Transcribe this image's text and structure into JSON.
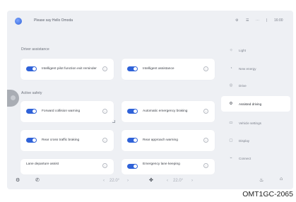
{
  "topbar": {
    "voice_prompt": "Please say Hello Omoda",
    "status_items": [
      "⚙",
      "☰",
      "⋯",
      "|",
      "16:00"
    ]
  },
  "driver_assistance": {
    "title": "Driver assistance",
    "cards": [
      {
        "label": "Intelligent pilot function exit reminder",
        "on": true
      },
      {
        "label": "Intelligent assistance",
        "on": true
      }
    ]
  },
  "active_safety": {
    "title": "Active safety",
    "cards": [
      {
        "label": "Forward collision warning",
        "on": true
      },
      {
        "label": "Automatic emergency braking",
        "on": true
      },
      {
        "label": "Rear cross traffic braking",
        "on": true
      },
      {
        "label": "Rear approach warning",
        "on": true
      },
      {
        "label": "Lane departure assist",
        "on": false
      },
      {
        "label": "Emergency lane keeping",
        "on": true
      }
    ]
  },
  "menu": {
    "items": [
      {
        "label": "Light",
        "icon": "☼"
      },
      {
        "label": "New energy",
        "icon": "◔"
      },
      {
        "label": "Drive",
        "icon": "◎"
      },
      {
        "label": "Assisted driving",
        "icon": "⚙"
      },
      {
        "label": "Vehicle settings",
        "icon": "▭"
      },
      {
        "label": "Display",
        "icon": "▢"
      },
      {
        "label": "Connect",
        "icon": "⌁"
      }
    ],
    "active_index": 3
  },
  "bottombar": {
    "left_temp": "22.0°",
    "right_temp": "22.0°"
  },
  "figure_code": "OMT1GC-2065"
}
